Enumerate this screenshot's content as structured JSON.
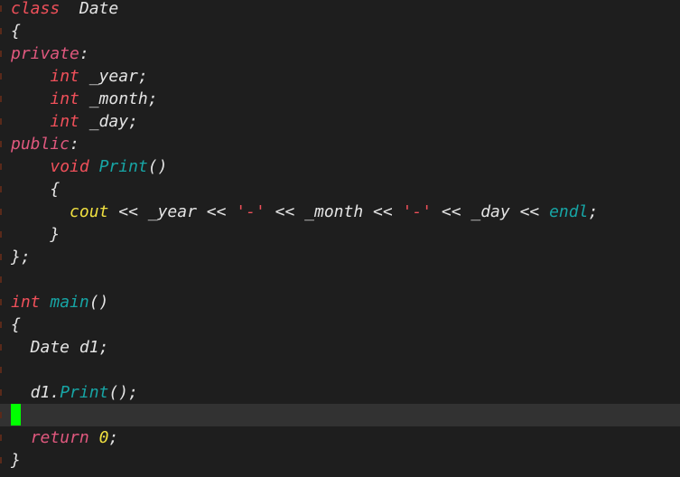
{
  "colors": {
    "background": "#1e1e1e",
    "current_line": "#323232",
    "cursor": "#00ff00",
    "keyword": "#f0505a",
    "access": "#e0587e",
    "function": "#17a5a5",
    "identifier_builtin": "#f0e040",
    "text": "#e4e4e4"
  },
  "editor": {
    "current_line_index": 18,
    "lines": [
      [
        [
          "kw",
          "class"
        ],
        [
          "",
          "  Date"
        ]
      ],
      [
        [
          "",
          "{"
        ]
      ],
      [
        [
          "acc",
          "private"
        ],
        [
          "",
          ":"
        ]
      ],
      [
        [
          "",
          "    "
        ],
        [
          "kw",
          "int"
        ],
        [
          "",
          " _year;"
        ]
      ],
      [
        [
          "",
          "    "
        ],
        [
          "kw",
          "int"
        ],
        [
          "",
          " _month;"
        ]
      ],
      [
        [
          "",
          "    "
        ],
        [
          "kw",
          "int"
        ],
        [
          "",
          " _day;"
        ]
      ],
      [
        [
          "acc",
          "public"
        ],
        [
          "",
          ":"
        ]
      ],
      [
        [
          "",
          "    "
        ],
        [
          "kw",
          "void"
        ],
        [
          "",
          " "
        ],
        [
          "fn",
          "Print"
        ],
        [
          "",
          "()"
        ]
      ],
      [
        [
          "",
          "    {"
        ]
      ],
      [
        [
          "",
          "      "
        ],
        [
          "yl",
          "cout"
        ],
        [
          "",
          " << _year << "
        ],
        [
          "str",
          "'-'"
        ],
        [
          "",
          " << _month << "
        ],
        [
          "str",
          "'-'"
        ],
        [
          "",
          " << _day << "
        ],
        [
          "fn",
          "endl"
        ],
        [
          "",
          ";"
        ]
      ],
      [
        [
          "",
          "    }"
        ]
      ],
      [
        [
          "",
          "};"
        ]
      ],
      [],
      [
        [
          "kw",
          "int"
        ],
        [
          "",
          " "
        ],
        [
          "fn",
          "main"
        ],
        [
          "",
          "()"
        ]
      ],
      [
        [
          "",
          "{"
        ]
      ],
      [
        [
          "",
          "  Date d1;"
        ]
      ],
      [],
      [
        [
          "",
          "  d1."
        ],
        [
          "fn",
          "Print"
        ],
        [
          "",
          "();"
        ]
      ],
      [],
      [
        [
          "",
          "  "
        ],
        [
          "acc",
          "return"
        ],
        [
          "",
          " "
        ],
        [
          "num",
          "0"
        ],
        [
          "",
          ";"
        ]
      ],
      [
        [
          "",
          "}"
        ]
      ]
    ]
  }
}
